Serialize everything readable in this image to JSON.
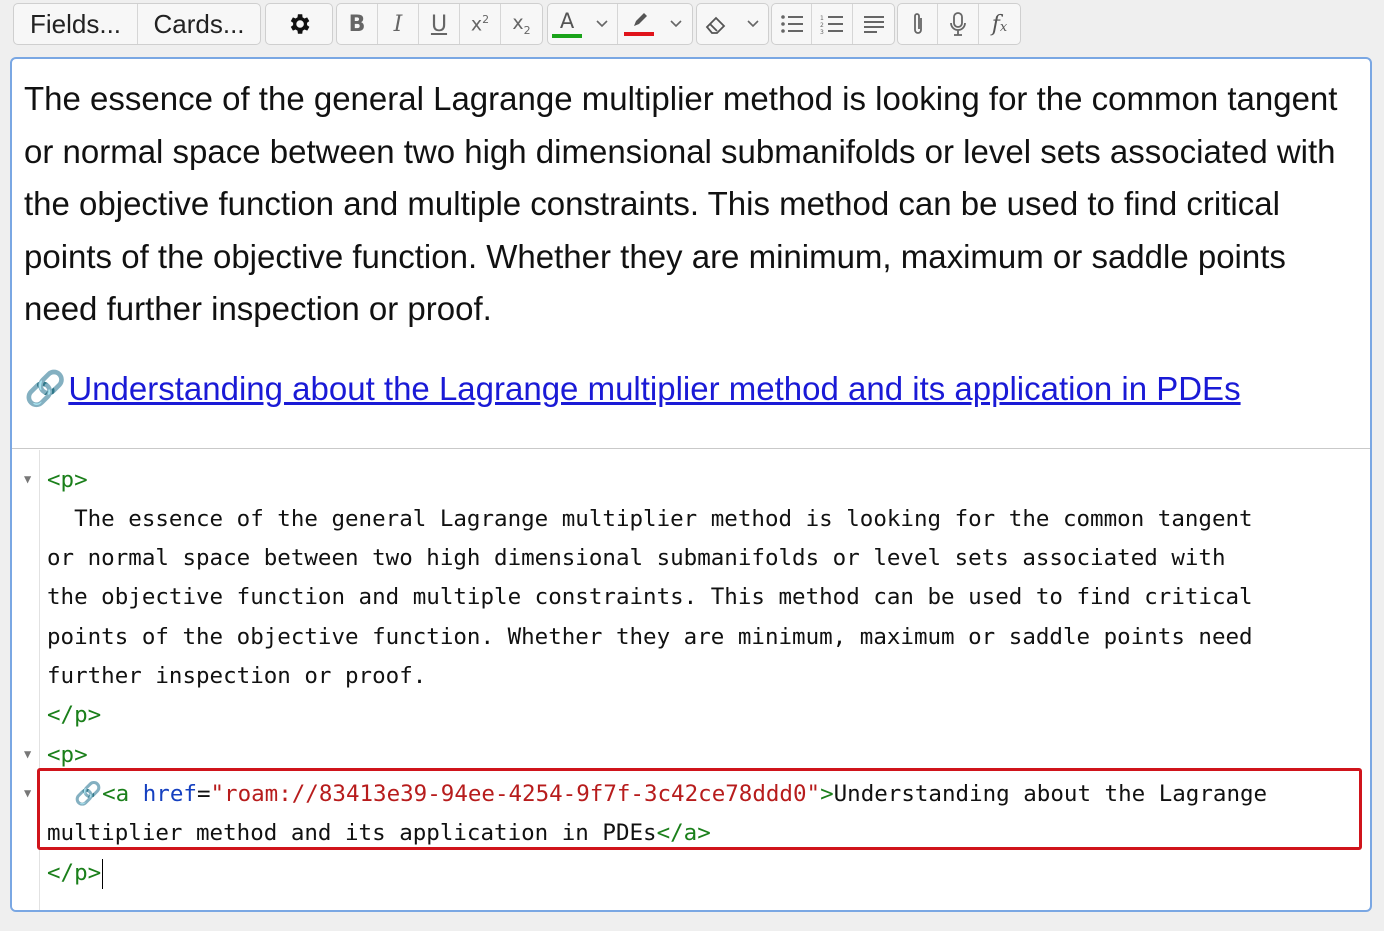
{
  "toolbar": {
    "fields_label": "Fields...",
    "cards_label": "Cards...",
    "icons": [
      "gear-icon",
      "bold-icon",
      "italic-icon",
      "underline-icon",
      "superscript-icon",
      "subscript-icon",
      "text-color-icon",
      "chevron-down-icon",
      "highlight-icon",
      "chevron-down-icon",
      "eraser-icon",
      "chevron-down-icon",
      "bullet-list-icon",
      "numbered-list-icon",
      "align-icon",
      "paperclip-icon",
      "microphone-icon",
      "function-icon"
    ],
    "text_color": "#1aa31a",
    "highlight_color": "#e0141b"
  },
  "rich": {
    "paragraph": "The essence of the general Lagrange multiplier method is looking for the common tangent or normal space between two high dimensional submanifolds or level sets associated with the objective function and multiple constraints. This method can be used to find critical points of the objective function. Whether they are minimum, maximum or saddle points need further inspection or proof.",
    "link_icon": "🔗",
    "link_text": "Understanding about the Lagrange multiplier method and its application in PDEs"
  },
  "code": {
    "p_open": "<p>",
    "p_close": "</p>",
    "text_lines": [
      "  The essence of the general Lagrange multiplier method is looking for the common tangent",
      "or normal space between two high dimensional submanifolds or level sets associated with",
      "the objective function and multiple constraints. This method can be used to find critical",
      "points of the objective function. Whether they are minimum, maximum or saddle points need",
      "further inspection or proof."
    ],
    "link_line": {
      "indent": "  ",
      "icon": "🔗",
      "a_open": "<a ",
      "attr": "href",
      "eq": "=",
      "value": "\"roam://83413e39-94ee-4254-9f7f-3c42ce78ddd0\"",
      "gt": ">",
      "text1": "Understanding about the Lagrange",
      "text2": "multiplier method and its application in PDEs",
      "a_close": "</a>"
    }
  }
}
